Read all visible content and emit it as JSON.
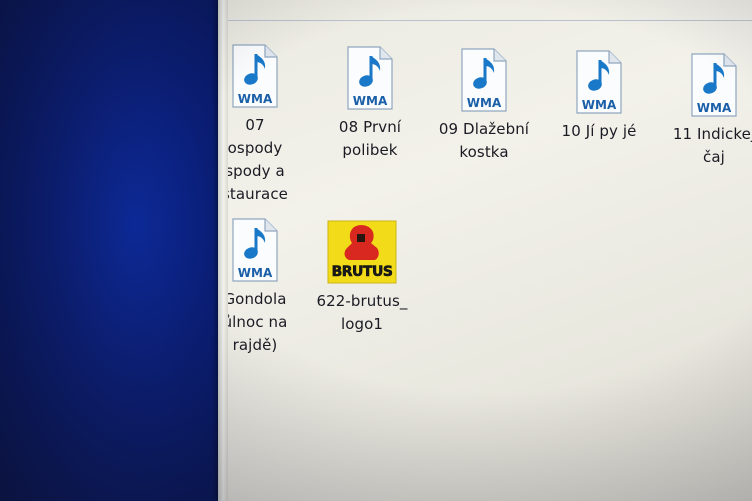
{
  "colors": {
    "desktop_blue": "#0a1d73",
    "pane_background": "#ecebe2",
    "wma_blue": "#1a78c8",
    "brutus_yellow": "#f2dc1a",
    "brutus_red": "#d8281f"
  },
  "files": [
    {
      "icon": "wma-audio-file-icon",
      "badge": "WMA",
      "label": "07\nospody\nspody a\nstaurace"
    },
    {
      "icon": "wma-audio-file-icon",
      "badge": "WMA",
      "label": "08 První\npolibek"
    },
    {
      "icon": "wma-audio-file-icon",
      "badge": "WMA",
      "label": "09 Dlažební\nkostka"
    },
    {
      "icon": "wma-audio-file-icon",
      "badge": "WMA",
      "label": "10 Jí py jé"
    },
    {
      "icon": "wma-audio-file-icon",
      "badge": "WMA",
      "label": "11 Indickej\nčaj"
    },
    {
      "icon": "wma-audio-file-icon",
      "badge": "WMA",
      "label": "Gondola\nůlnoc na\nrajdě)"
    },
    {
      "icon": "brutus-logo-image-icon",
      "badge": "BRUTUS",
      "label": "622-brutus_\nlogo1"
    }
  ]
}
